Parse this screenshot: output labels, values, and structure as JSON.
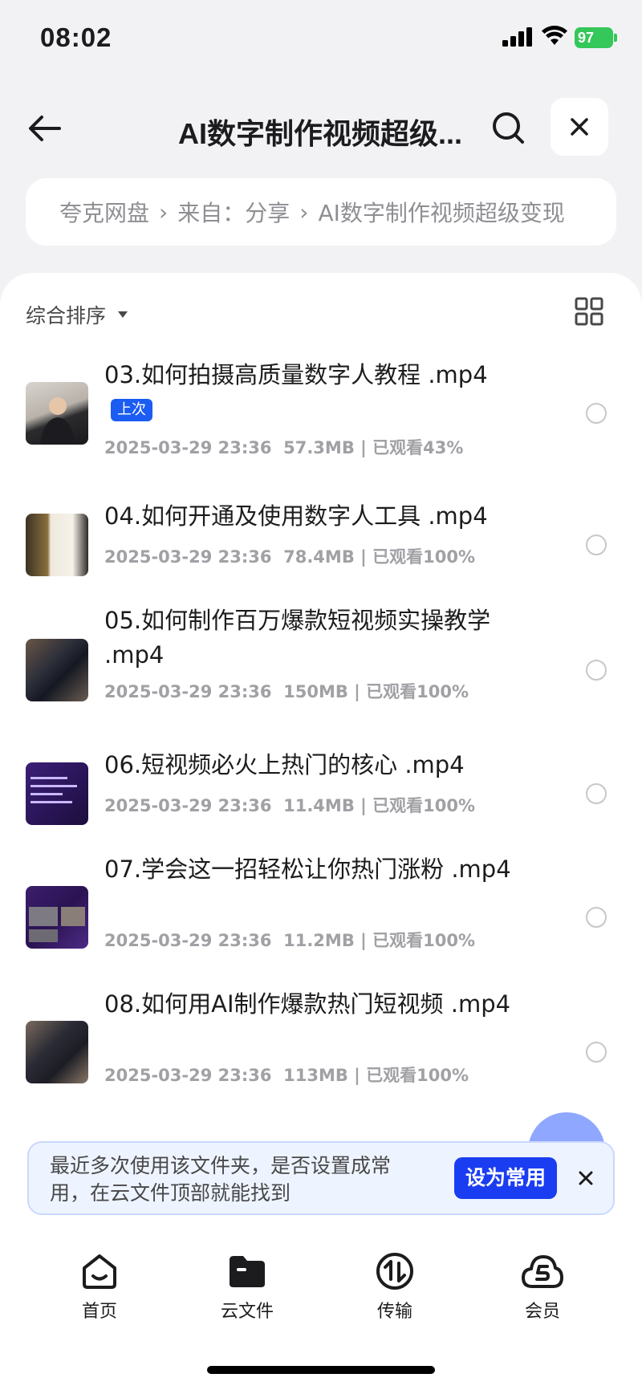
{
  "status_bar": {
    "time": "08:02",
    "battery": "97"
  },
  "header": {
    "title": "AI数字制作视频超级..."
  },
  "breadcrumb": [
    {
      "label": "夸克网盘"
    },
    {
      "label": "来自：分享"
    },
    {
      "label": "AI数字制作视频超级变现"
    }
  ],
  "breadcrumb_separator": "›",
  "sort": {
    "label": "综合排序"
  },
  "files": [
    {
      "name": "03.如何拍摄高质量数字人教程 .mp4",
      "badge": "上次",
      "date": "2025-03-29 23:36",
      "size": "57.3MB",
      "progress": "已观看43%"
    },
    {
      "name": "04.如何开通及使用数字人工具 .mp4",
      "date": "2025-03-29 23:36",
      "size": "78.4MB",
      "progress": "已观看100%"
    },
    {
      "name": "05.如何制作百万爆款短视频实操教学 .mp4",
      "date": "2025-03-29 23:36",
      "size": "150MB",
      "progress": "已观看100%"
    },
    {
      "name": "06.短视频必火上热门的核心 .mp4",
      "date": "2025-03-29 23:36",
      "size": "11.4MB",
      "progress": "已观看100%"
    },
    {
      "name": "07.学会这一招轻松让你热门涨粉 .mp4",
      "date": "2025-03-29 23:36",
      "size": "11.2MB",
      "progress": "已观看100%"
    },
    {
      "name": "08.如何用AI制作爆款热门短视频 .mp4",
      "date": "2025-03-29 23:36",
      "size": "113MB",
      "progress": "已观看100%"
    }
  ],
  "banner": {
    "text": "最近多次使用该文件夹，是否设置成常用，在云文件顶部就能找到",
    "button": "设为常用"
  },
  "tabs": [
    {
      "label": "首页"
    },
    {
      "label": "云文件"
    },
    {
      "label": "传输"
    },
    {
      "label": "会员"
    }
  ],
  "colors": {
    "accent": "#1b3df2",
    "badge": "#1b5cf2",
    "battery": "#34c759"
  }
}
